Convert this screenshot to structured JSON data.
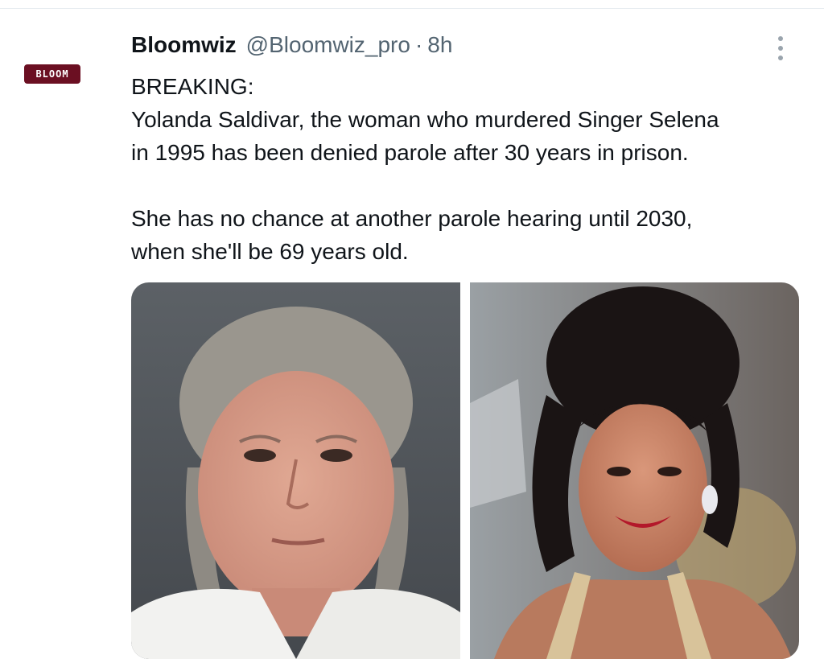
{
  "author": {
    "display_name": "Bloomwiz",
    "handle": "@Bloomwiz_pro",
    "separator": "·",
    "time_ago": "8h",
    "avatar_text": "BLOOM"
  },
  "tweet": {
    "line1": "BREAKING:",
    "line2": "Yolanda Saldivar, the woman who murdered Singer Selena",
    "line3": "in 1995 has been denied parole after 30 years in prison.",
    "line4": "She has no chance at another parole hearing until 2030,",
    "line5": "when she'll be 69 years old."
  },
  "icons": {
    "more": "more-vertical-icon"
  },
  "colors": {
    "avatar_bg": "#6b0f22",
    "text": "#0f1419",
    "secondary_text": "#536471",
    "divider": "#e6ecf0"
  }
}
